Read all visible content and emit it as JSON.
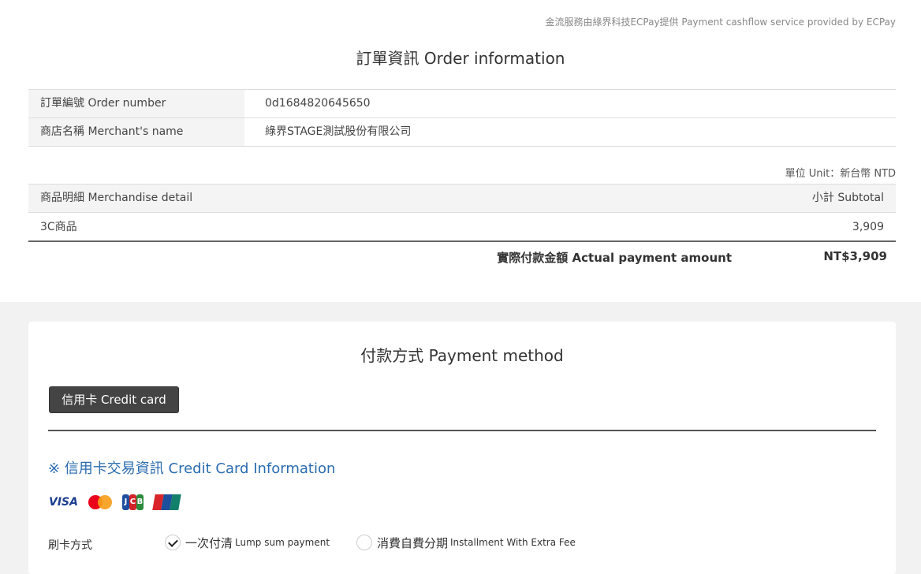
{
  "provider_note": "金流服務由綠界科技ECPay提供 Payment cashflow service provided by ECPay",
  "order": {
    "title": "訂單資訊 Order information",
    "rows": [
      {
        "label": "訂單編號 Order number",
        "value": "0d1684820645650"
      },
      {
        "label": "商店名稱 Merchant's name",
        "value": "綠界STAGE測試股份有限公司"
      }
    ]
  },
  "unit_note": "單位 Unit：新台幣 NTD",
  "merchandise": {
    "header_detail": "商品明細 Merchandise detail",
    "header_subtotal": "小計 Subtotal",
    "items": [
      {
        "name": "3C商品",
        "subtotal": "3,909"
      }
    ]
  },
  "total": {
    "label": "實際付款金額 Actual payment amount",
    "value": "NT$3,909"
  },
  "payment": {
    "title": "付款方式 Payment method",
    "tab_credit_card": "信用卡 Credit card",
    "cc_info_heading": "※ 信用卡交易資訊 Credit Card Information",
    "logos": {
      "visa": "VISA",
      "mastercard": "mastercard-logo",
      "jcb": "jcb-logo",
      "unionpay": "unionpay-logo"
    },
    "payment_type_label": "刷卡方式",
    "options": [
      {
        "main": "一次付清",
        "sub": "Lump sum payment",
        "checked": true
      },
      {
        "main": "消費自費分期",
        "sub": "Installment With Extra Fee",
        "checked": false
      }
    ]
  },
  "colors": {
    "page_bg": "#f2f2f2",
    "heading_blue": "#2b6cb0",
    "tab_bg": "#444444",
    "row_label_bg": "#f4f4f4"
  }
}
